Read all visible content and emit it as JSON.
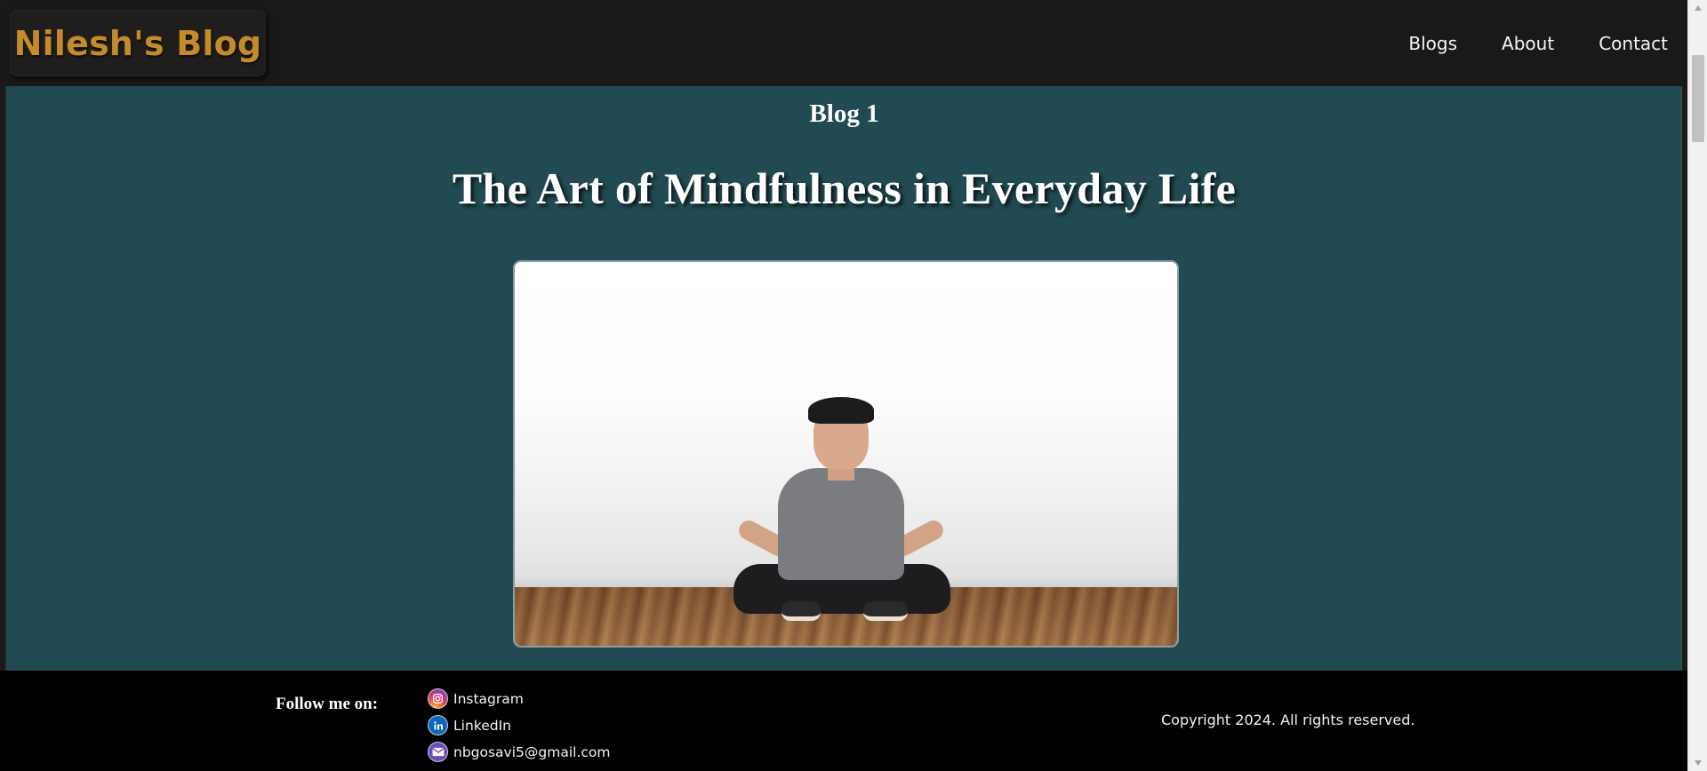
{
  "header": {
    "brand": "Nilesh's Blog",
    "nav": [
      {
        "label": "Blogs"
      },
      {
        "label": "About"
      },
      {
        "label": "Contact"
      }
    ]
  },
  "main": {
    "blog_number": "Blog 1",
    "title": "The Art of Mindfulness in Everyday Life",
    "image_alt": "Man meditating cross-legged on a wooden floor"
  },
  "footer": {
    "follow_label": "Follow me on:",
    "social": [
      {
        "icon": "instagram-icon",
        "label": "Instagram"
      },
      {
        "icon": "linkedin-icon",
        "label": "LinkedIn"
      },
      {
        "icon": "email-icon",
        "label": "nbgosavi5@gmail.com"
      }
    ],
    "copyright": "Copyright 2024. All rights reserved."
  },
  "colors": {
    "header_bg": "#1b1918",
    "brand_text": "#c28b2b",
    "main_bg": "#224a52",
    "footer_bg": "#000000"
  }
}
